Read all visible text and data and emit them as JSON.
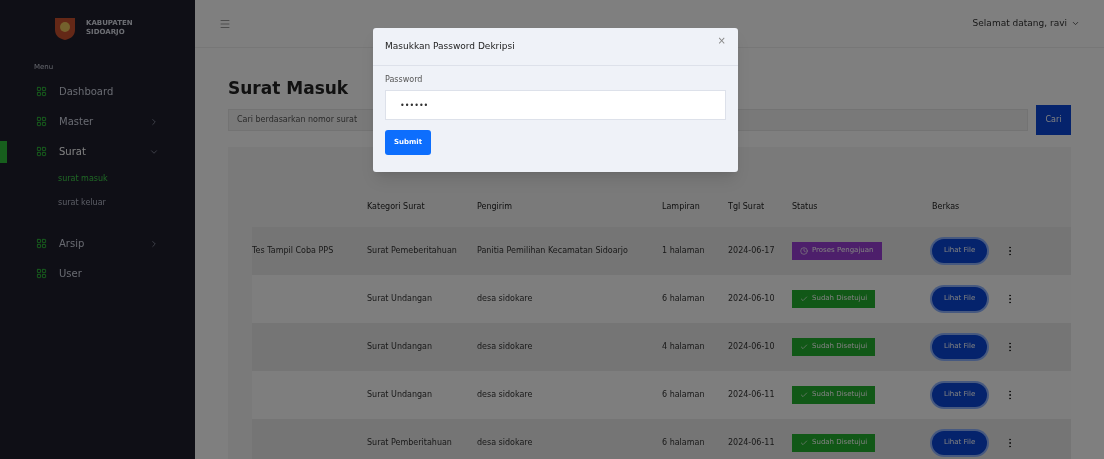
{
  "sidebar": {
    "brand": [
      "KABUPATEN",
      "SIDOARJO"
    ],
    "section": "Menu",
    "items": [
      {
        "label": "Dashboard",
        "selected": false,
        "expandable": false
      },
      {
        "label": "Master",
        "selected": false,
        "expandable": true,
        "expanded": false
      },
      {
        "label": "Surat",
        "selected": true,
        "expandable": true,
        "expanded": true,
        "children": [
          {
            "label": "surat masuk",
            "selected": true
          },
          {
            "label": "surat keluar",
            "selected": false
          }
        ]
      },
      {
        "label": "Arsip",
        "selected": false,
        "expandable": true,
        "expanded": false
      },
      {
        "label": "User",
        "selected": false,
        "expandable": false
      }
    ]
  },
  "header": {
    "greeting": "Selamat datang, ravi"
  },
  "page_title": "Surat Masuk",
  "search": {
    "placeholder": "Cari berdasarkan nomor surat",
    "button": "Cari"
  },
  "table": {
    "columns": [
      "Kategori Surat",
      "Pengirim",
      "Lampiran",
      "Tgl Surat",
      "Status",
      "Berkas"
    ],
    "rows": [
      {
        "column_1": "Tes Tampil Coba PPS",
        "kategori": "Surat Pemeberitahuan",
        "pengirim": "Panitia Pemilihan Kecamatan Sidoarjo",
        "lampiran": "1 halaman",
        "tgl": "2024-06-17",
        "status": {
          "kind": "process",
          "label": "Proses Pengajuan"
        },
        "berkas": "Lihat File"
      },
      {
        "kategori": "Surat Undangan",
        "pengirim": "desa sidokare",
        "lampiran": "6 halaman",
        "tgl": "2024-06-10",
        "status": {
          "kind": "approved",
          "label": "Sudah Disetujui"
        },
        "berkas": "Lihat File"
      },
      {
        "kategori": "Surat Undangan",
        "pengirim": "desa sidokare",
        "lampiran": "4 halaman",
        "tgl": "2024-06-10",
        "status": {
          "kind": "approved",
          "label": "Sudah Disetujui"
        },
        "berkas": "Lihat File"
      },
      {
        "kategori": "Surat Undangan",
        "pengirim": "desa sidokare",
        "lampiran": "6 halaman",
        "tgl": "2024-06-11",
        "status": {
          "kind": "approved",
          "label": "Sudah Disetujui"
        },
        "berkas": "Lihat File"
      },
      {
        "kategori": "Surat Pemberitahuan",
        "pengirim": "desa sidokare",
        "lampiran": "6 halaman",
        "tgl": "2024-06-11",
        "status": {
          "kind": "approved",
          "label": "Sudah Disetujui"
        },
        "berkas": "Lihat File"
      }
    ]
  },
  "modal": {
    "title": "Masukkan Password Dekripsi",
    "close": "×",
    "label": "Password",
    "value": "••••••",
    "submit": "Submit"
  }
}
